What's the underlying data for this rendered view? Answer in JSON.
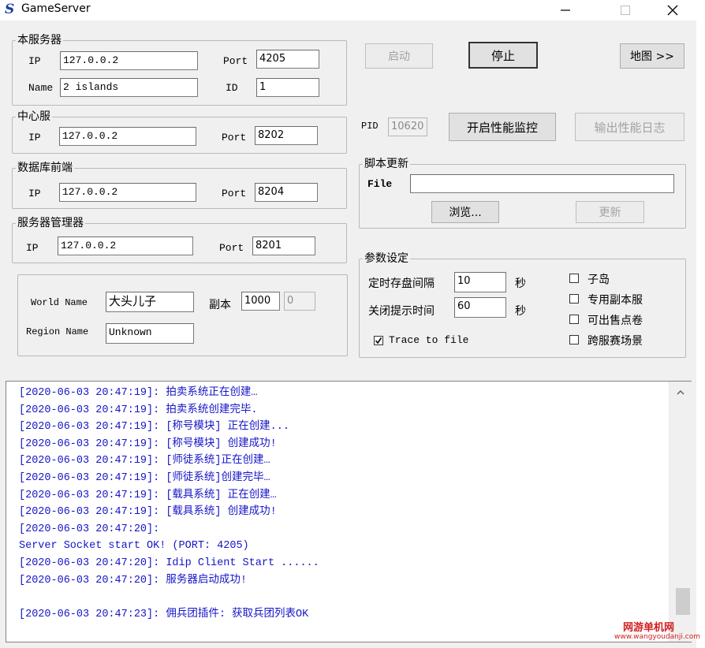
{
  "window": {
    "title": "GameServer",
    "logo_glyph": "S"
  },
  "local_server": {
    "legend": "本服务器",
    "ip_label": "IP",
    "ip": "127.0.0.2",
    "port_label": "Port",
    "port": "4205",
    "name_label": "Name",
    "name": "2 islands",
    "id_label": "ID",
    "id": "1"
  },
  "center_server": {
    "legend": "中心服",
    "ip_label": "IP",
    "ip": "127.0.0.2",
    "port_label": "Port",
    "port": "8202"
  },
  "db_frontend": {
    "legend": "数据库前端",
    "ip_label": "IP",
    "ip": "127.0.0.2",
    "port_label": "Port",
    "port": "8204"
  },
  "server_manager": {
    "legend": "服务器管理器",
    "ip_label": "IP",
    "ip": "127.0.0.2",
    "port_label": "Port",
    "port": "8201"
  },
  "world": {
    "world_name_label": "World Name",
    "world_name": "大头儿子",
    "instance_label": "副本",
    "instance": "1000",
    "instance2": "0",
    "region_name_label": "Region Name",
    "region_name": "Unknown"
  },
  "buttons": {
    "start": "启动",
    "stop": "停止",
    "map": "地图 >>",
    "perf_monitor": "开启性能监控",
    "perf_log": "输出性能日志"
  },
  "pid": {
    "label": "PID",
    "value": "10620"
  },
  "script_update": {
    "legend": "脚本更新",
    "file_label": "File",
    "file_value": "",
    "browse": "浏览...",
    "update": "更新"
  },
  "params": {
    "legend": "参数设定",
    "autosave_label": "定时存盘间隔",
    "autosave_value": "10",
    "autosave_unit": "秒",
    "shutdown_label": "关闭提示时间",
    "shutdown_value": "60",
    "shutdown_unit": "秒",
    "trace_label": "Trace to file",
    "trace_checked": true,
    "options": [
      {
        "label": "子岛",
        "checked": false
      },
      {
        "label": "专用副本服",
        "checked": false
      },
      {
        "label": "可出售点卷",
        "checked": false
      },
      {
        "label": "跨服赛场景",
        "checked": false
      }
    ]
  },
  "log": [
    "[2020-06-03 20:47:19]: 拍卖系统正在创建…",
    "[2020-06-03 20:47:19]: 拍卖系统创建完毕.",
    "[2020-06-03 20:47:19]: [称号模块] 正在创建...",
    "[2020-06-03 20:47:19]: [称号模块] 创建成功!",
    "[2020-06-03 20:47:19]: [师徒系统]正在创建…",
    "[2020-06-03 20:47:19]: [师徒系统]创建完毕…",
    "[2020-06-03 20:47:19]: [载具系统] 正在创建…",
    "[2020-06-03 20:47:19]: [载具系统] 创建成功!",
    "[2020-06-03 20:47:20]:",
    "Server Socket start OK! (PORT: 4205)",
    "[2020-06-03 20:47:20]:  Idip Client Start ......",
    "[2020-06-03 20:47:20]: 服务器启动成功!",
    "",
    "[2020-06-03 20:47:23]: 佣兵团插件: 获取兵团列表OK"
  ],
  "watermark": {
    "cn": "网游单机网",
    "url": "www.wangyoudanji.com"
  },
  "colors": {
    "log_text": "#1515c8",
    "logo": "#1a3fa8",
    "watermark": "#d21e1e"
  }
}
